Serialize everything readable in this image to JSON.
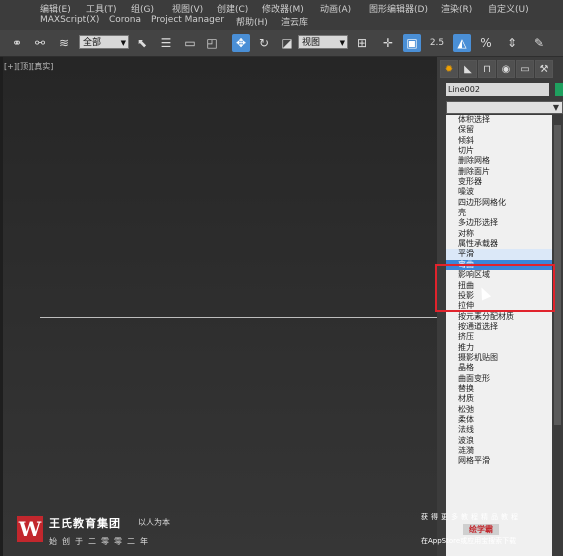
{
  "menubar": {
    "row1": [
      "编辑(E)",
      "工具(T)",
      "组(G)",
      "视图(V)",
      "创建(C)",
      "修改器(M)",
      "动画(A)",
      "图形编辑器(D)",
      "渲染(R)",
      "自定义(U)"
    ],
    "row2": [
      "MAXScript(X)",
      "Corona",
      "Project Manager",
      "帮助(H)",
      "渲云库"
    ]
  },
  "toolbar": {
    "selection_filter": "全部",
    "coordinate_system": "视图",
    "snap_angle_label": "2.5",
    "snap_percent_label": "%"
  },
  "viewport": {
    "label": "[+][顶][真实]"
  },
  "command_panel": {
    "object_name": "Line002",
    "accent_color": "#1fa05f",
    "modifier_list": [
      "体积选择",
      "保留",
      "倾斜",
      "切片",
      "删除网格",
      "删除面片",
      "变形器",
      "噪波",
      "四边形网格化",
      "壳",
      "多边形选择",
      "对称",
      "属性承载器",
      "平滑",
      "弯曲",
      "影响区域",
      "扭曲",
      "投影",
      "拉伸",
      "按元素分配材质",
      "按通道选择",
      "挤压",
      "推力",
      "摄影机贴图",
      "晶格",
      "曲面变形",
      "替换",
      "材质",
      "松弛",
      "柔体",
      "法线",
      "波浪",
      "涟漪",
      "网格平滑"
    ],
    "hover_index": 13,
    "selected_index": 14
  },
  "branding": {
    "org_name": "王氏教育集团",
    "slogan": "以人为本",
    "motto": "始创于二零零二年",
    "watermark_line1": "获得更多教程精品教程",
    "watermark_line2": "绘学霸",
    "watermark_line3": "在AppStore或应用宝搜索下载"
  }
}
